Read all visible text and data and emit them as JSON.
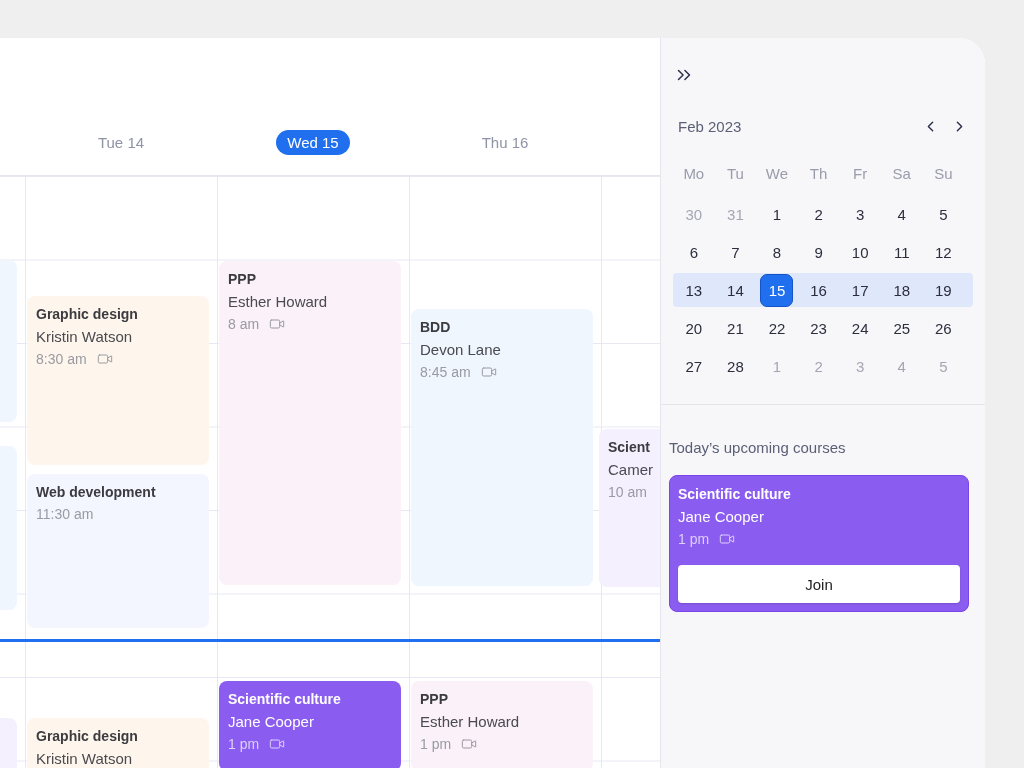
{
  "columns": [
    {
      "events": [
        {
          "kind": "soft",
          "color": "#eff6fe"
        },
        {
          "kind": "soft",
          "color": "#eff6fe"
        },
        {
          "kind": "soft",
          "color": "#f5f0fe"
        }
      ]
    },
    {
      "header": {
        "label": "Tue 14",
        "selected": false
      },
      "events": [
        {
          "kind": "soft",
          "color": "#fef6ec",
          "title": "Graphic design",
          "person": "Kristin Watson",
          "time": "8:30 am",
          "video": true
        },
        {
          "kind": "soft",
          "color": "#f3f6fe",
          "title": "Web development",
          "time": "11:30 am",
          "video": false
        },
        {
          "kind": "soft",
          "color": "#fef6ec",
          "title": "Graphic design",
          "person": "Kristin Watson",
          "video": false
        }
      ]
    },
    {
      "header": {
        "label": "Wed 15",
        "selected": true
      },
      "events": [
        {
          "kind": "soft",
          "color": "#fbf1f8",
          "title": "PPP",
          "person": "Esther Howard",
          "time": "8 am",
          "video": true
        },
        {
          "kind": "accent",
          "color": "#8b5cf0",
          "title": "Scientific culture",
          "person": "Jane Cooper",
          "time": "1 pm",
          "video": true
        }
      ]
    },
    {
      "header": {
        "label": "Thu 16",
        "selected": false
      },
      "events": [
        {
          "kind": "soft",
          "color": "#eff6fe",
          "title": "BDD",
          "person": "Devon Lane",
          "time": "8:45 am",
          "video": true
        },
        {
          "kind": "soft",
          "color": "#fbf1f8",
          "title": "PPP",
          "person": "Esther Howard",
          "time": "1 pm",
          "video": true
        }
      ]
    },
    {
      "events": [
        {
          "kind": "soft",
          "color": "#f5f0fe",
          "title": "Scient",
          "person": "Camer",
          "time": "10 am",
          "video": false
        }
      ]
    }
  ],
  "calendar": {
    "month": "Feb 2023",
    "weekdays": [
      "Mo",
      "Tu",
      "We",
      "Th",
      "Fr",
      "Sa",
      "Su"
    ],
    "weeks": [
      {
        "highlighted": false,
        "days": [
          {
            "label": "30",
            "muted": true,
            "selected": false
          },
          {
            "label": "31",
            "muted": true,
            "selected": false
          },
          {
            "label": "1",
            "muted": false,
            "selected": false
          },
          {
            "label": "2",
            "muted": false,
            "selected": false
          },
          {
            "label": "3",
            "muted": false,
            "selected": false
          },
          {
            "label": "4",
            "muted": false,
            "selected": false
          },
          {
            "label": "5",
            "muted": false,
            "selected": false
          }
        ]
      },
      {
        "highlighted": false,
        "days": [
          {
            "label": "6",
            "muted": false,
            "selected": false
          },
          {
            "label": "7",
            "muted": false,
            "selected": false
          },
          {
            "label": "8",
            "muted": false,
            "selected": false
          },
          {
            "label": "9",
            "muted": false,
            "selected": false
          },
          {
            "label": "10",
            "muted": false,
            "selected": false
          },
          {
            "label": "11",
            "muted": false,
            "selected": false
          },
          {
            "label": "12",
            "muted": false,
            "selected": false
          }
        ]
      },
      {
        "highlighted": true,
        "days": [
          {
            "label": "13",
            "muted": false,
            "selected": false
          },
          {
            "label": "14",
            "muted": false,
            "selected": false
          },
          {
            "label": "15",
            "muted": false,
            "selected": true
          },
          {
            "label": "16",
            "muted": false,
            "selected": false
          },
          {
            "label": "17",
            "muted": false,
            "selected": false
          },
          {
            "label": "18",
            "muted": false,
            "selected": false
          },
          {
            "label": "19",
            "muted": false,
            "selected": false
          }
        ]
      },
      {
        "highlighted": false,
        "days": [
          {
            "label": "20",
            "muted": false,
            "selected": false
          },
          {
            "label": "21",
            "muted": false,
            "selected": false
          },
          {
            "label": "22",
            "muted": false,
            "selected": false
          },
          {
            "label": "23",
            "muted": false,
            "selected": false
          },
          {
            "label": "24",
            "muted": false,
            "selected": false
          },
          {
            "label": "25",
            "muted": false,
            "selected": false
          },
          {
            "label": "26",
            "muted": false,
            "selected": false
          }
        ]
      },
      {
        "highlighted": false,
        "days": [
          {
            "label": "27",
            "muted": false,
            "selected": false
          },
          {
            "label": "28",
            "muted": false,
            "selected": false
          },
          {
            "label": "1",
            "muted": true,
            "selected": false
          },
          {
            "label": "2",
            "muted": true,
            "selected": false
          },
          {
            "label": "3",
            "muted": true,
            "selected": false
          },
          {
            "label": "4",
            "muted": true,
            "selected": false
          },
          {
            "label": "5",
            "muted": true,
            "selected": false
          }
        ]
      }
    ]
  },
  "upcoming": {
    "title": "Today’s upcoming courses",
    "course": {
      "kind": "accent",
      "color": "#8b5cf0",
      "title": "Scientific culture",
      "person": "Jane Cooper",
      "time": "1 pm",
      "video": true,
      "button": "Join"
    }
  }
}
